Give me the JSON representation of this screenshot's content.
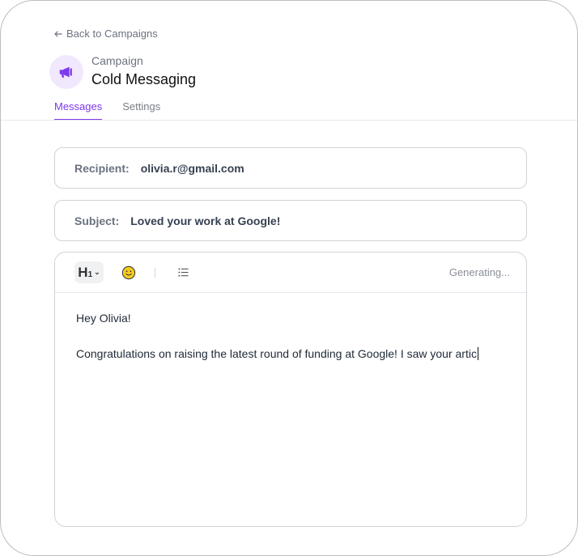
{
  "nav": {
    "back_label": "Back to Campaigns"
  },
  "header": {
    "kicker": "Campaign",
    "title": "Cold Messaging"
  },
  "tabs": [
    {
      "label": "Messages",
      "active": true
    },
    {
      "label": "Settings",
      "active": false
    }
  ],
  "recipient": {
    "label": "Recipient:",
    "value": "olivia.r@gmail.com"
  },
  "subject": {
    "label": "Subject:",
    "value": "Loved your work at Google!"
  },
  "editor": {
    "heading_button": {
      "main": "H",
      "sub": "1",
      "chevron": "⌄"
    },
    "status": "Generating...",
    "greeting": "Hey Olivia!",
    "body_text": "Congratulations on raising the latest round of funding at Google! I saw your artic"
  },
  "icons": {
    "back": "arrow-left-icon",
    "avatar": "megaphone-icon",
    "emoji": "smiley-icon",
    "list": "bullet-list-icon"
  },
  "colors": {
    "accent": "#7c3aed",
    "avatar_bg": "#f1e8fd",
    "emoji": "#f5cc1e"
  }
}
